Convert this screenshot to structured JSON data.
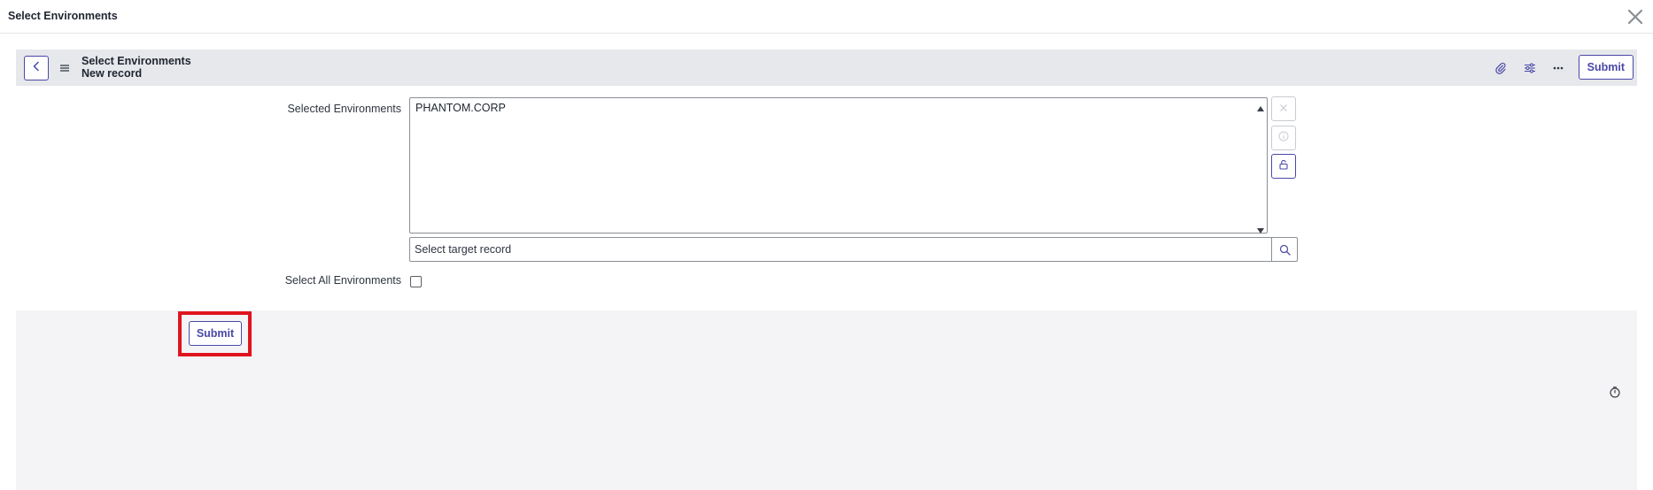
{
  "dialog": {
    "title": "Select Environments",
    "close_icon": "close-icon"
  },
  "form_header": {
    "title": "Select Environments",
    "subtitle": "New record",
    "back_icon": "chevron-left-icon",
    "menu_icon": "hamburger-icon",
    "actions": {
      "attachment_icon": "paperclip-icon",
      "settings_icon": "sliders-icon",
      "more_icon": "more-icon",
      "submit_label": "Submit"
    }
  },
  "form": {
    "selected_environments": {
      "label": "Selected Environments",
      "items": [
        "PHANTOM.CORP"
      ],
      "remove_icon": "close-icon",
      "info_icon": "info-icon",
      "lock_icon": "unlock-icon"
    },
    "reference": {
      "placeholder": "Select target record",
      "search_icon": "search-icon"
    },
    "select_all": {
      "label": "Select All Environments",
      "checked": false
    }
  },
  "footer": {
    "submit_label": "Submit",
    "timer_icon": "timer-icon"
  },
  "colors": {
    "accent": "#4a48a7",
    "header_bg": "#e6e8eb",
    "footer_bg": "#f4f4f6",
    "highlight": "#e0141e"
  }
}
